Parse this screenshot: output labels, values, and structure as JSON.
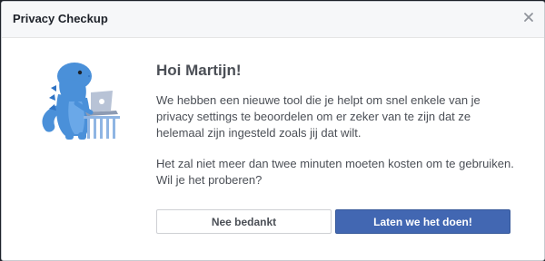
{
  "dialog": {
    "title": "Privacy Checkup",
    "close_icon": "close-icon",
    "mascot_icon": "privacy-dinosaur-mascot"
  },
  "content": {
    "greeting": "Hoi Martijn!",
    "paragraph1": "We hebben een nieuwe tool die je helpt om snel enkele van je privacy settings te beoordelen om er zeker van te zijn dat ze helemaal zijn ingesteld zoals jij dat wilt.",
    "paragraph2": "Het zal niet meer dan twee minuten moeten kosten om te gebruiken. Wil je het proberen?"
  },
  "buttons": {
    "decline_label": "Nee bedankt",
    "accept_label": "Laten we het doen!"
  },
  "colors": {
    "primary": "#4267b2",
    "mascot": "#4a90d9"
  }
}
